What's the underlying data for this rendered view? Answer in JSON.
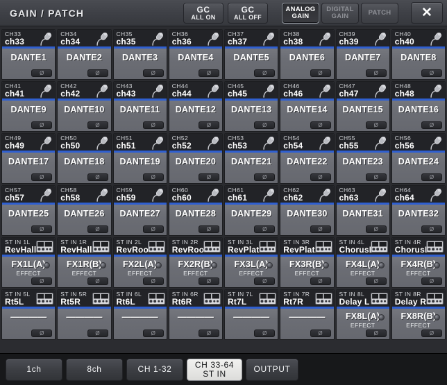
{
  "header": {
    "title": "GAIN / PATCH",
    "gc_all_on": {
      "line1": "GC",
      "line2": "ALL ON"
    },
    "gc_all_off": {
      "line1": "GC",
      "line2": "ALL OFF"
    },
    "modes": [
      {
        "line1": "ANALOG",
        "line2": "GAIN",
        "state": "active"
      },
      {
        "line1": "DIGITAL",
        "line2": "GAIN",
        "state": "disabled"
      },
      {
        "line1": "PATCH",
        "line2": "",
        "state": "disabled"
      }
    ],
    "close_label": "✕"
  },
  "colors": {
    "accent_blue": "#2f5fd0",
    "strip_body": "#6e7077",
    "strip_head": "#222327",
    "window_bg": "#2b2c30",
    "tabbar_bg": "#17181a",
    "selected_tab": "#f2f2f0"
  },
  "strips": [
    [
      {
        "ch": "CH33",
        "name": "ch33",
        "patch": "DANTE1",
        "sub": "",
        "icon": "mic-icon",
        "knob": false
      },
      {
        "ch": "CH34",
        "name": "ch34",
        "patch": "DANTE2",
        "sub": "",
        "icon": "mic-icon",
        "knob": false
      },
      {
        "ch": "CH35",
        "name": "ch35",
        "patch": "DANTE3",
        "sub": "",
        "icon": "mic-icon",
        "knob": false
      },
      {
        "ch": "CH36",
        "name": "ch36",
        "patch": "DANTE4",
        "sub": "",
        "icon": "mic-icon",
        "knob": false
      },
      {
        "ch": "CH37",
        "name": "ch37",
        "patch": "DANTE5",
        "sub": "",
        "icon": "mic-icon",
        "knob": false
      },
      {
        "ch": "CH38",
        "name": "ch38",
        "patch": "DANTE6",
        "sub": "",
        "icon": "mic-icon",
        "knob": false
      },
      {
        "ch": "CH39",
        "name": "ch39",
        "patch": "DANTE7",
        "sub": "",
        "icon": "mic-icon",
        "knob": false
      },
      {
        "ch": "CH40",
        "name": "ch40",
        "patch": "DANTE8",
        "sub": "",
        "icon": "mic-icon",
        "knob": false
      }
    ],
    [
      {
        "ch": "CH41",
        "name": "ch41",
        "patch": "DANTE9",
        "sub": "",
        "icon": "mic-icon",
        "knob": false
      },
      {
        "ch": "CH42",
        "name": "ch42",
        "patch": "DANTE10",
        "sub": "",
        "icon": "mic-icon",
        "knob": false
      },
      {
        "ch": "CH43",
        "name": "ch43",
        "patch": "DANTE11",
        "sub": "",
        "icon": "mic-icon",
        "knob": false
      },
      {
        "ch": "CH44",
        "name": "ch44",
        "patch": "DANTE12",
        "sub": "",
        "icon": "mic-icon",
        "knob": false
      },
      {
        "ch": "CH45",
        "name": "ch45",
        "patch": "DANTE13",
        "sub": "",
        "icon": "mic-icon",
        "knob": false
      },
      {
        "ch": "CH46",
        "name": "ch46",
        "patch": "DANTE14",
        "sub": "",
        "icon": "mic-icon",
        "knob": false
      },
      {
        "ch": "CH47",
        "name": "ch47",
        "patch": "DANTE15",
        "sub": "",
        "icon": "mic-icon",
        "knob": false
      },
      {
        "ch": "CH48",
        "name": "ch48",
        "patch": "DANTE16",
        "sub": "",
        "icon": "mic-icon",
        "knob": false
      }
    ],
    [
      {
        "ch": "CH49",
        "name": "ch49",
        "patch": "DANTE17",
        "sub": "",
        "icon": "mic-icon",
        "knob": false
      },
      {
        "ch": "CH50",
        "name": "ch50",
        "patch": "DANTE18",
        "sub": "",
        "icon": "mic-icon",
        "knob": false
      },
      {
        "ch": "CH51",
        "name": "ch51",
        "patch": "DANTE19",
        "sub": "",
        "icon": "mic-icon",
        "knob": false
      },
      {
        "ch": "CH52",
        "name": "ch52",
        "patch": "DANTE20",
        "sub": "",
        "icon": "mic-icon",
        "knob": false
      },
      {
        "ch": "CH53",
        "name": "ch53",
        "patch": "DANTE21",
        "sub": "",
        "icon": "mic-icon",
        "knob": false
      },
      {
        "ch": "CH54",
        "name": "ch54",
        "patch": "DANTE22",
        "sub": "",
        "icon": "mic-icon",
        "knob": false
      },
      {
        "ch": "CH55",
        "name": "ch55",
        "patch": "DANTE23",
        "sub": "",
        "icon": "mic-icon",
        "knob": false
      },
      {
        "ch": "CH56",
        "name": "ch56",
        "patch": "DANTE24",
        "sub": "",
        "icon": "mic-icon",
        "knob": false
      }
    ],
    [
      {
        "ch": "CH57",
        "name": "ch57",
        "patch": "DANTE25",
        "sub": "",
        "icon": "mic-icon",
        "knob": false
      },
      {
        "ch": "CH58",
        "name": "ch58",
        "patch": "DANTE26",
        "sub": "",
        "icon": "mic-icon",
        "knob": false
      },
      {
        "ch": "CH59",
        "name": "ch59",
        "patch": "DANTE27",
        "sub": "",
        "icon": "mic-icon",
        "knob": false
      },
      {
        "ch": "CH60",
        "name": "ch60",
        "patch": "DANTE28",
        "sub": "",
        "icon": "mic-icon",
        "knob": false
      },
      {
        "ch": "CH61",
        "name": "ch61",
        "patch": "DANTE29",
        "sub": "",
        "icon": "mic-icon",
        "knob": false
      },
      {
        "ch": "CH62",
        "name": "ch62",
        "patch": "DANTE30",
        "sub": "",
        "icon": "mic-icon",
        "knob": false
      },
      {
        "ch": "CH63",
        "name": "ch63",
        "patch": "DANTE31",
        "sub": "",
        "icon": "mic-icon",
        "knob": false
      },
      {
        "ch": "CH64",
        "name": "ch64",
        "patch": "DANTE32",
        "sub": "",
        "icon": "mic-icon",
        "knob": false
      }
    ],
    [
      {
        "ch": "ST IN 1L",
        "name": "RevHallL",
        "patch": "FX1L(A)",
        "sub": "EFFECT",
        "icon": "effect-rack-icon",
        "knob": true
      },
      {
        "ch": "ST IN 1R",
        "name": "RevHallR",
        "patch": "FX1R(B)",
        "sub": "EFFECT",
        "icon": "effect-rack-icon",
        "knob": true
      },
      {
        "ch": "ST IN 2L",
        "name": "RevRoomL",
        "patch": "FX2L(A)",
        "sub": "EFFECT",
        "icon": "effect-rack-icon",
        "knob": true
      },
      {
        "ch": "ST IN 2R",
        "name": "RevRoomR",
        "patch": "FX2R(B)",
        "sub": "EFFECT",
        "icon": "effect-rack-icon",
        "knob": true
      },
      {
        "ch": "ST IN 3L",
        "name": "RevPlatL",
        "patch": "FX3L(A)",
        "sub": "EFFECT",
        "icon": "effect-rack-icon",
        "knob": true
      },
      {
        "ch": "ST IN 3R",
        "name": "RevPlatR",
        "patch": "FX3R(B)",
        "sub": "EFFECT",
        "icon": "effect-rack-icon",
        "knob": true
      },
      {
        "ch": "ST IN 4L",
        "name": "ChorusL",
        "patch": "FX4L(A)",
        "sub": "EFFECT",
        "icon": "effect-rack-icon",
        "knob": true
      },
      {
        "ch": "ST IN 4R",
        "name": "ChorusR",
        "patch": "FX4R(B)",
        "sub": "EFFECT",
        "icon": "effect-rack-icon",
        "knob": true
      }
    ],
    [
      {
        "ch": "ST IN 5L",
        "name": "Rt5L",
        "patch": "————",
        "sub": "",
        "icon": "effect-rack-icon",
        "knob": false
      },
      {
        "ch": "ST IN 5R",
        "name": "Rt5R",
        "patch": "————",
        "sub": "",
        "icon": "effect-rack-icon",
        "knob": false
      },
      {
        "ch": "ST IN 6L",
        "name": "Rt6L",
        "patch": "————",
        "sub": "",
        "icon": "effect-rack-icon",
        "knob": false
      },
      {
        "ch": "ST IN 6R",
        "name": "Rt6R",
        "patch": "————",
        "sub": "",
        "icon": "effect-rack-icon",
        "knob": false
      },
      {
        "ch": "ST IN 7L",
        "name": "Rt7L",
        "patch": "————",
        "sub": "",
        "icon": "effect-rack-icon",
        "knob": false
      },
      {
        "ch": "ST IN 7R",
        "name": "Rt7R",
        "patch": "————",
        "sub": "",
        "icon": "effect-rack-icon",
        "knob": false
      },
      {
        "ch": "ST IN 8L",
        "name": "Delay L",
        "patch": "FX8L(A)",
        "sub": "EFFECT",
        "icon": "effect-rack-icon",
        "knob": true
      },
      {
        "ch": "ST IN 8R",
        "name": "Delay R",
        "patch": "FX8R(B)",
        "sub": "EFFECT",
        "icon": "effect-rack-icon",
        "knob": true
      }
    ]
  ],
  "phase_symbol": "Ø",
  "tabs": [
    {
      "line1": "1ch",
      "line2": "",
      "selected": false
    },
    {
      "line1": "8ch",
      "line2": "",
      "selected": false
    },
    {
      "line1": "CH 1-32",
      "line2": "",
      "selected": false
    },
    {
      "line1": "CH 33-64",
      "line2": "ST IN",
      "selected": true
    },
    {
      "line1": "OUTPUT",
      "line2": "",
      "selected": false
    }
  ]
}
